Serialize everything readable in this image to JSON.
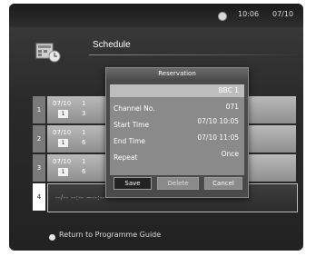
{
  "topbar": {
    "time": "10:06",
    "date": "07/10",
    "clock_icon": "clock-icon"
  },
  "page": {
    "title": "Schedule",
    "header_icon": "schedule-icon"
  },
  "list": {
    "rows": [
      {
        "num": "1",
        "date": "07/10",
        "ch": "1",
        "time": "1",
        "dur": "3"
      },
      {
        "num": "2",
        "date": "07/10",
        "ch": "1",
        "time": "1",
        "dur": "6"
      },
      {
        "num": "3",
        "date": "07/10",
        "ch": "1",
        "time": "1",
        "dur": "6"
      },
      {
        "num": "4",
        "empty": "--/--    --:-- ~--:--"
      }
    ]
  },
  "footer": {
    "label": "Return to Programme Guide"
  },
  "dialog": {
    "title": "Reservation",
    "channel_name": "BBC 1",
    "fields": {
      "channel_no_label": "Channel No.",
      "channel_no": "071",
      "start_label": "Start Time",
      "start_value": "07/10 10:05",
      "end_label": "End Time",
      "end_value": "07/10 11:05",
      "repeat_label": "Repeat",
      "repeat_value": "Once"
    },
    "buttons": {
      "save": "Save",
      "delete": "Delete",
      "cancel": "Cancel"
    }
  }
}
